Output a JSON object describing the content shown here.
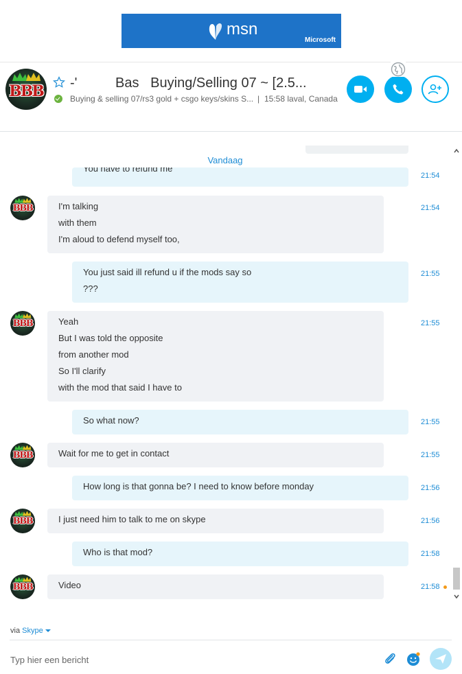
{
  "banner": {
    "logo_text": "msn",
    "brand": "Microsoft",
    "color": "#1e73c8"
  },
  "header": {
    "contact_name": "-'          Bas   Buying/Selling 07 ~ [2.5...",
    "mood": "Buying & selling 07/rs3 gold + csgo keys/skins S...",
    "separator": "|",
    "location": "15:58 laval, Canada",
    "status": "online",
    "accent_color": "#00aff0",
    "icons": [
      "star-icon",
      "video-call-icon",
      "audio-call-icon",
      "add-participant-icon",
      "globe-icon"
    ]
  },
  "chat": {
    "date_separator": "Vandaag",
    "messages": [
      {
        "dir": "out",
        "lines": [
          "You have to refund me"
        ],
        "time": "21:54"
      },
      {
        "dir": "in",
        "lines": [
          "I'm talking",
          "with them",
          "I'm aloud to defend myself too,"
        ],
        "time": "21:54"
      },
      {
        "dir": "out",
        "lines": [
          "You just said ill refund u if the mods say so",
          "???"
        ],
        "time": "21:55"
      },
      {
        "dir": "in",
        "lines": [
          "Yeah",
          "But I was told the opposite",
          "from another mod",
          "So I'll clarify",
          "with the mod that said I have to"
        ],
        "time": "21:55"
      },
      {
        "dir": "out",
        "lines": [
          "So what now?"
        ],
        "time": "21:55"
      },
      {
        "dir": "in",
        "lines": [
          "Wait for me to get in contact"
        ],
        "time": "21:55"
      },
      {
        "dir": "out",
        "lines": [
          "How long is that gonna be? I need to know before monday"
        ],
        "time": "21:56"
      },
      {
        "dir": "in",
        "lines": [
          "I just need him to talk to me on skype"
        ],
        "time": "21:56"
      },
      {
        "dir": "out",
        "lines": [
          "Who is that mod?"
        ],
        "time": "21:58"
      },
      {
        "dir": "in",
        "lines": [
          "Video"
        ],
        "time": "21:58"
      }
    ],
    "avatar_text": "BBB"
  },
  "footer": {
    "via_label": "via",
    "via_service": "Skype",
    "compose_placeholder": "Typ hier een bericht",
    "icons": [
      "attach-icon",
      "emoji-icon",
      "send-icon"
    ]
  }
}
